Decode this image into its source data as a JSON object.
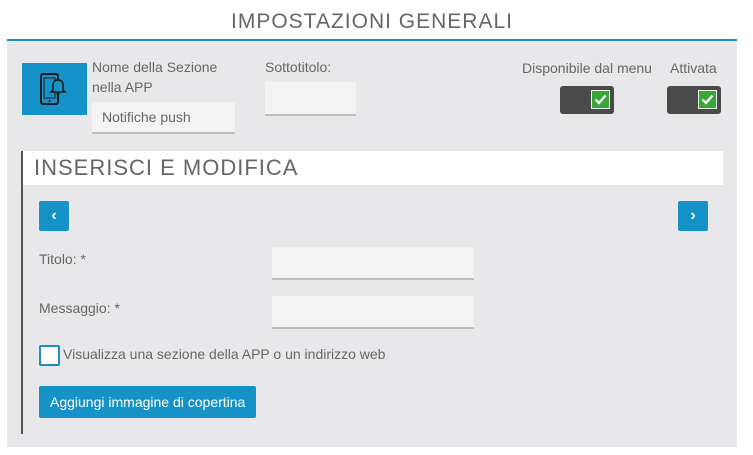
{
  "header": {
    "title": "IMPOSTAZIONI GENERALI"
  },
  "settings": {
    "icon": "mobile-notification-icon",
    "section_name_label": "Nome della Sezione\nnella APP",
    "section_name_value": "Notifiche push",
    "subtitle_label": "Sottotitolo:",
    "subtitle_value": "",
    "menu_available_label": "Disponibile dal menu",
    "menu_available_checked": true,
    "enabled_label": "Attivata",
    "enabled_checked": true
  },
  "editor": {
    "title": "INSERISCI E MODIFICA",
    "prev_label": "‹",
    "next_label": "›",
    "title_label": "Titolo: *",
    "title_value": "",
    "message_label": "Messaggio: *",
    "message_value": "",
    "link_checkbox_label": "Visualizza una sezione della APP o un indirizzo web",
    "link_checkbox_checked": false,
    "cover_button_label": "Aggiungi immagine di copertina"
  },
  "colors": {
    "accent": "#1593c9",
    "panel_bg": "#e8e8ea",
    "toggle_bg": "#4a4a4a",
    "toggle_on": "#3aa63a"
  }
}
